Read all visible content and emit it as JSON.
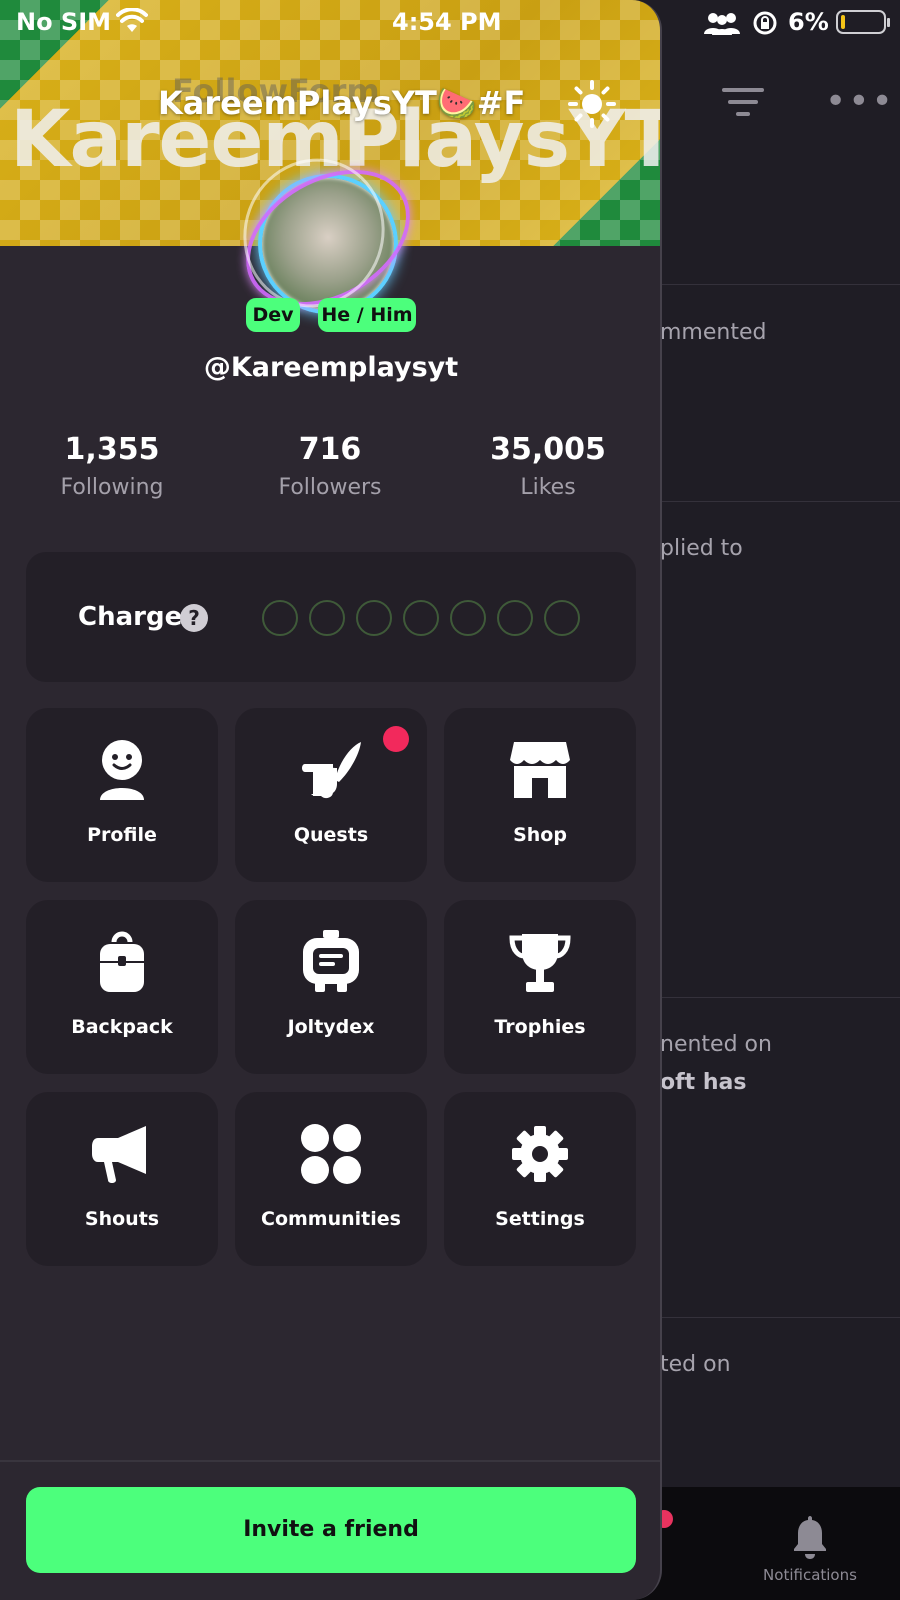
{
  "status_bar": {
    "carrier": "No SIM",
    "time": "4:54 PM",
    "battery_percent": "6%"
  },
  "background_feed": {
    "rows": [
      {
        "text": "mmented"
      },
      {
        "text": "plied to"
      },
      {
        "text": "nented on",
        "bold": "oft has"
      },
      {
        "text": "ted on"
      }
    ],
    "tab_label": "Notifications"
  },
  "drawer": {
    "banner_title": "KareemPlaysYT🍉#F",
    "banner_bg_text": "KareemPlaysYT",
    "banner_ghost_text": "FollowForm",
    "badges": {
      "dev": "Dev",
      "pronouns": "He / Him"
    },
    "handle": "@Kareemplaysyt",
    "stats": [
      {
        "value": "1,355",
        "label": "Following"
      },
      {
        "value": "716",
        "label": "Followers"
      },
      {
        "value": "35,005",
        "label": "Likes"
      }
    ],
    "charge": {
      "label": "Charge",
      "help": "?",
      "slots_filled": 0,
      "slots_total": 7
    },
    "menu": [
      {
        "label": "Profile",
        "icon": "profile-icon"
      },
      {
        "label": "Quests",
        "icon": "quill-scroll-icon",
        "has_notification": true
      },
      {
        "label": "Shop",
        "icon": "storefront-icon"
      },
      {
        "label": "Backpack",
        "icon": "backpack-icon"
      },
      {
        "label": "Joltydex",
        "icon": "joltydex-icon"
      },
      {
        "label": "Trophies",
        "icon": "trophy-icon"
      },
      {
        "label": "Shouts",
        "icon": "megaphone-icon"
      },
      {
        "label": "Communities",
        "icon": "communities-icon"
      },
      {
        "label": "Settings",
        "icon": "gear-icon"
      }
    ],
    "invite_label": "Invite a friend"
  },
  "colors": {
    "accent_green": "#4cff7c",
    "drawer_bg": "#2c2730",
    "tile_bg": "#231f27",
    "notification_red": "#f2295c"
  }
}
